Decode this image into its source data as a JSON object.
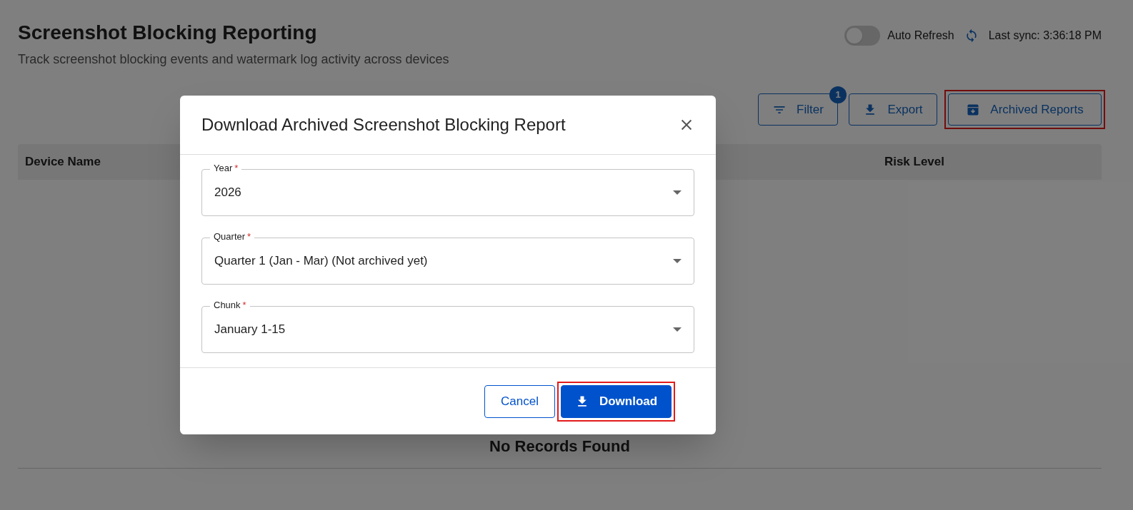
{
  "page": {
    "title": "Screenshot Blocking Reporting",
    "subtitle": "Track screenshot blocking events and watermark log activity across devices",
    "auto_refresh": {
      "label": "Auto Refresh",
      "on": false
    },
    "last_sync": "Last sync: 3:36:18 PM",
    "actions": [
      {
        "label": "Filter",
        "badge": "1",
        "highlighted": false
      },
      {
        "label": "Export",
        "highlighted": false
      },
      {
        "label": "Archived Reports",
        "highlighted": true
      }
    ],
    "table": {
      "columns": [
        "Device Name",
        "Risk Level"
      ],
      "empty_message": "No Records Found"
    }
  },
  "dialog": {
    "title": "Download Archived Screenshot Blocking Report",
    "fields": [
      {
        "label": "Year",
        "required_mark": "*",
        "value": "2026"
      },
      {
        "label": "Quarter",
        "required_mark": "*",
        "value": "Quarter 1 (Jan - Mar) (Not archived yet)"
      },
      {
        "label": "Chunk",
        "required_mark": "*",
        "value": "January 1-15"
      }
    ],
    "buttons": [
      {
        "label": "Cancel",
        "kind": "secondary",
        "highlighted": false
      },
      {
        "label": "Download",
        "kind": "primary",
        "highlighted": true
      }
    ]
  }
}
